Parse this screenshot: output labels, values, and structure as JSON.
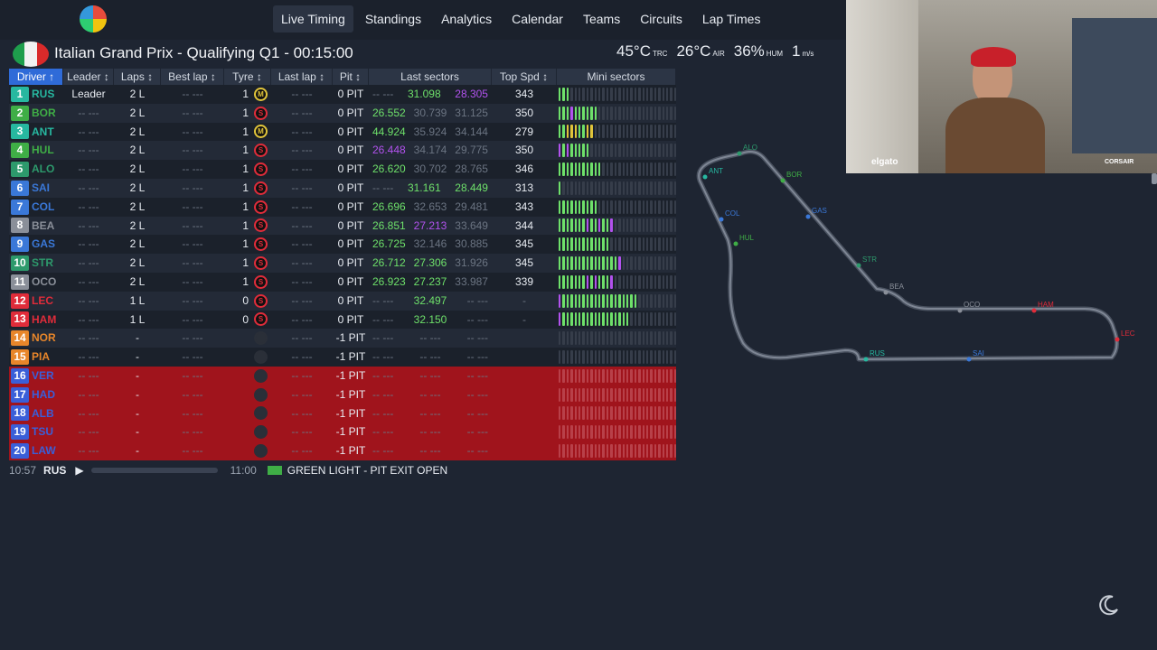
{
  "nav": [
    "Live Timing",
    "Standings",
    "Analytics",
    "Calendar",
    "Teams",
    "Circuits",
    "Lap Times"
  ],
  "session": {
    "title": "Italian Grand Prix - Qualifying Q1",
    "timer": "00:15:00",
    "track_temp": "45°C",
    "track_label": "TRC",
    "air_temp": "26°C",
    "air_label": "AIR",
    "humidity": "36%",
    "hum_label": "HUM",
    "wind": "1",
    "wind_unit": "m/s"
  },
  "headers": [
    "Driver ↑",
    "Leader ↕",
    "Laps ↕",
    "Best lap ↕",
    "Tyre ↕",
    "Last lap ↕",
    "Pit ↕",
    "Last sectors",
    "Top Spd ↕",
    "Mini sectors"
  ],
  "colors": {
    "green": "#6ee06a",
    "purple": "#b252ee",
    "yellow": "#e0c43a",
    "out_row": "#a0141c",
    "accent": "#2b3342"
  },
  "drivers": [
    {
      "pos": "1",
      "code": "RUS",
      "team": "#27b8a0",
      "leader": "Leader",
      "laps": "2 L",
      "best": "-- ---",
      "tyre_num": "1",
      "tyre": "M",
      "last": "-- ---",
      "pit": "0 PIT",
      "s1": "-- ---",
      "s2": "31.098",
      "s3": "28.305",
      "s1c": "dim",
      "s2c": "grn",
      "s3c": "pur",
      "top": "343",
      "mini": "GGG"
    },
    {
      "pos": "2",
      "code": "BOR",
      "team": "#3fae46",
      "leader": "-- ---",
      "laps": "2 L",
      "best": "-- ---",
      "tyre_num": "1",
      "tyre": "S",
      "last": "-- ---",
      "pit": "0 PIT",
      "s1": "26.552",
      "s2": "30.739",
      "s3": "31.125",
      "s1c": "grn",
      "s2c": "dim",
      "s3c": "dim",
      "top": "350",
      "mini": "GGGPGGGGGG"
    },
    {
      "pos": "3",
      "code": "ANT",
      "team": "#27b8a0",
      "leader": "-- ---",
      "laps": "2 L",
      "best": "-- ---",
      "tyre_num": "1",
      "tyre": "M",
      "last": "-- ---",
      "pit": "0 PIT",
      "s1": "44.924",
      "s2": "35.924",
      "s3": "34.144",
      "s1c": "grn",
      "s2c": "dim",
      "s3c": "dim",
      "top": "279",
      "mini": "GGYYYGGYY"
    },
    {
      "pos": "4",
      "code": "HUL",
      "team": "#3fae46",
      "leader": "-- ---",
      "laps": "2 L",
      "best": "-- ---",
      "tyre_num": "1",
      "tyre": "S",
      "last": "-- ---",
      "pit": "0 PIT",
      "s1": "26.448",
      "s2": "34.174",
      "s3": "29.775",
      "s1c": "pur",
      "s2c": "dim",
      "s3c": "dim",
      "top": "350",
      "mini": "PGPGGGGG"
    },
    {
      "pos": "5",
      "code": "ALO",
      "team": "#2d9a6c",
      "leader": "-- ---",
      "laps": "2 L",
      "best": "-- ---",
      "tyre_num": "1",
      "tyre": "S",
      "last": "-- ---",
      "pit": "0 PIT",
      "s1": "26.620",
      "s2": "30.702",
      "s3": "28.765",
      "s1c": "grn",
      "s2c": "dim",
      "s3c": "dim",
      "top": "346",
      "mini": "GGGGGGGGGGG"
    },
    {
      "pos": "6",
      "code": "SAI",
      "team": "#3a78d8",
      "leader": "-- ---",
      "laps": "2 L",
      "best": "-- ---",
      "tyre_num": "1",
      "tyre": "S",
      "last": "-- ---",
      "pit": "0 PIT",
      "s1": "-- ---",
      "s2": "31.161",
      "s3": "28.449",
      "s1c": "dim",
      "s2c": "grn",
      "s3c": "grn",
      "top": "313",
      "mini": "G"
    },
    {
      "pos": "7",
      "code": "COL",
      "team": "#3a78d8",
      "leader": "-- ---",
      "laps": "2 L",
      "best": "-- ---",
      "tyre_num": "1",
      "tyre": "S",
      "last": "-- ---",
      "pit": "0 PIT",
      "s1": "26.696",
      "s2": "32.653",
      "s3": "29.481",
      "s1c": "grn",
      "s2c": "dim",
      "s3c": "dim",
      "top": "343",
      "mini": "GGGGGGGGGG"
    },
    {
      "pos": "8",
      "code": "BEA",
      "team": "#8a8f99",
      "leader": "-- ---",
      "laps": "2 L",
      "best": "-- ---",
      "tyre_num": "1",
      "tyre": "S",
      "last": "-- ---",
      "pit": "0 PIT",
      "s1": "26.851",
      "s2": "27.213",
      "s3": "33.649",
      "s1c": "grn",
      "s2c": "pur",
      "s3c": "dim",
      "top": "344",
      "mini": "GGGGGGGPGGPGGP"
    },
    {
      "pos": "9",
      "code": "GAS",
      "team": "#3a78d8",
      "leader": "-- ---",
      "laps": "2 L",
      "best": "-- ---",
      "tyre_num": "1",
      "tyre": "S",
      "last": "-- ---",
      "pit": "0 PIT",
      "s1": "26.725",
      "s2": "32.146",
      "s3": "30.885",
      "s1c": "grn",
      "s2c": "dim",
      "s3c": "dim",
      "top": "345",
      "mini": "GGGGGGGGGGGGG"
    },
    {
      "pos": "10",
      "code": "STR",
      "team": "#2d9a6c",
      "leader": "-- ---",
      "laps": "2 L",
      "best": "-- ---",
      "tyre_num": "1",
      "tyre": "S",
      "last": "-- ---",
      "pit": "0 PIT",
      "s1": "26.712",
      "s2": "27.306",
      "s3": "31.926",
      "s1c": "grn",
      "s2c": "grn",
      "s3c": "dim",
      "top": "345",
      "mini": "GGGGGGGGGGGGGGGP"
    },
    {
      "pos": "11",
      "code": "OCO",
      "team": "#8a8f99",
      "leader": "-- ---",
      "laps": "2 L",
      "best": "-- ---",
      "tyre_num": "1",
      "tyre": "S",
      "last": "-- ---",
      "pit": "0 PIT",
      "s1": "26.923",
      "s2": "27.237",
      "s3": "33.987",
      "s1c": "grn",
      "s2c": "grn",
      "s3c": "dim",
      "top": "339",
      "mini": "GGGGGGGPGPGGGP"
    },
    {
      "pos": "12",
      "code": "LEC",
      "team": "#e02c3a",
      "leader": "-- ---",
      "laps": "1 L",
      "best": "-- ---",
      "tyre_num": "0",
      "tyre": "S",
      "last": "-- ---",
      "pit": "0 PIT",
      "s1": "-- ---",
      "s2": "32.497",
      "s3": "-- ---",
      "s1c": "dim",
      "s2c": "grn",
      "s3c": "dim",
      "top": "-",
      "mini": "PGGGGGGGGGGGGGGGGGGG"
    },
    {
      "pos": "13",
      "code": "HAM",
      "team": "#e02c3a",
      "leader": "-- ---",
      "laps": "1 L",
      "best": "-- ---",
      "tyre_num": "0",
      "tyre": "S",
      "last": "-- ---",
      "pit": "0 PIT",
      "s1": "-- ---",
      "s2": "32.150",
      "s3": "-- ---",
      "s1c": "dim",
      "s2c": "grn",
      "s3c": "dim",
      "top": "-",
      "mini": "PGGGGGGGGGGGGGGGGG"
    },
    {
      "pos": "14",
      "code": "NOR",
      "team": "#e8862a",
      "leader": "-- ---",
      "laps": "-",
      "best": "-- ---",
      "tyre_num": "",
      "tyre": "",
      "last": "-- ---",
      "pit": "-1 PIT",
      "s1": "-- ---",
      "s2": "-- ---",
      "s3": "-- ---",
      "s1c": "dim",
      "s2c": "dim",
      "s3c": "dim",
      "top": "",
      "mini": ""
    },
    {
      "pos": "15",
      "code": "PIA",
      "team": "#e8862a",
      "leader": "-- ---",
      "laps": "-",
      "best": "-- ---",
      "tyre_num": "",
      "tyre": "",
      "last": "-- ---",
      "pit": "-1 PIT",
      "s1": "-- ---",
      "s2": "-- ---",
      "s3": "-- ---",
      "s1c": "dim",
      "s2c": "dim",
      "s3c": "dim",
      "top": "",
      "mini": ""
    },
    {
      "pos": "16",
      "code": "VER",
      "team": "#3a5fd8",
      "leader": "-- ---",
      "laps": "-",
      "best": "-- ---",
      "tyre_num": "",
      "tyre": "",
      "last": "-- ---",
      "pit": "-1 PIT",
      "s1": "-- ---",
      "s2": "-- ---",
      "s3": "-- ---",
      "s1c": "dim",
      "s2c": "dim",
      "s3c": "dim",
      "top": "",
      "mini": "",
      "out": true
    },
    {
      "pos": "17",
      "code": "HAD",
      "team": "#3a5fd8",
      "leader": "-- ---",
      "laps": "-",
      "best": "-- ---",
      "tyre_num": "",
      "tyre": "",
      "last": "-- ---",
      "pit": "-1 PIT",
      "s1": "-- ---",
      "s2": "-- ---",
      "s3": "-- ---",
      "s1c": "dim",
      "s2c": "dim",
      "s3c": "dim",
      "top": "",
      "mini": "",
      "out": true
    },
    {
      "pos": "18",
      "code": "ALB",
      "team": "#3a5fd8",
      "leader": "-- ---",
      "laps": "-",
      "best": "-- ---",
      "tyre_num": "",
      "tyre": "",
      "last": "-- ---",
      "pit": "-1 PIT",
      "s1": "-- ---",
      "s2": "-- ---",
      "s3": "-- ---",
      "s1c": "dim",
      "s2c": "dim",
      "s3c": "dim",
      "top": "",
      "mini": "",
      "out": true
    },
    {
      "pos": "19",
      "code": "TSU",
      "team": "#3a5fd8",
      "leader": "-- ---",
      "laps": "-",
      "best": "-- ---",
      "tyre_num": "",
      "tyre": "",
      "last": "-- ---",
      "pit": "-1 PIT",
      "s1": "-- ---",
      "s2": "-- ---",
      "s3": "-- ---",
      "s1c": "dim",
      "s2c": "dim",
      "s3c": "dim",
      "top": "",
      "mini": "",
      "out": true
    },
    {
      "pos": "20",
      "code": "LAW",
      "team": "#3a5fd8",
      "leader": "-- ---",
      "laps": "-",
      "best": "-- ---",
      "tyre_num": "",
      "tyre": "",
      "last": "-- ---",
      "pit": "-1 PIT",
      "s1": "-- ---",
      "s2": "-- ---",
      "s3": "-- ---",
      "s1c": "dim",
      "s2c": "dim",
      "s3c": "dim",
      "top": "",
      "mini": "",
      "out": true
    }
  ],
  "status": {
    "time": "10:57",
    "driver": "RUS",
    "playback_time": "11:00",
    "message": "GREEN LIGHT - PIT EXIT OPEN",
    "message_color": "#3fae46"
  },
  "track_labels": [
    {
      "code": "ALO",
      "color": "#2d9a6c"
    },
    {
      "code": "ANT",
      "color": "#27b8a0"
    },
    {
      "code": "BOR",
      "color": "#3fae46"
    },
    {
      "code": "GAS",
      "color": "#3a78d8"
    },
    {
      "code": "COL",
      "color": "#3a78d8"
    },
    {
      "code": "HUL",
      "color": "#3fae46"
    },
    {
      "code": "STR",
      "color": "#2d9a6c"
    },
    {
      "code": "BEA",
      "color": "#8a8f99"
    },
    {
      "code": "OCO",
      "color": "#8a8f99"
    },
    {
      "code": "HAM",
      "color": "#e02c3a"
    },
    {
      "code": "LEC",
      "color": "#e02c3a"
    },
    {
      "code": "RUS",
      "color": "#27b8a0"
    },
    {
      "code": "SAI",
      "color": "#3a78d8"
    }
  ],
  "webcam": {
    "brand_left": "elgato",
    "brand_right": "CORSAIR"
  }
}
